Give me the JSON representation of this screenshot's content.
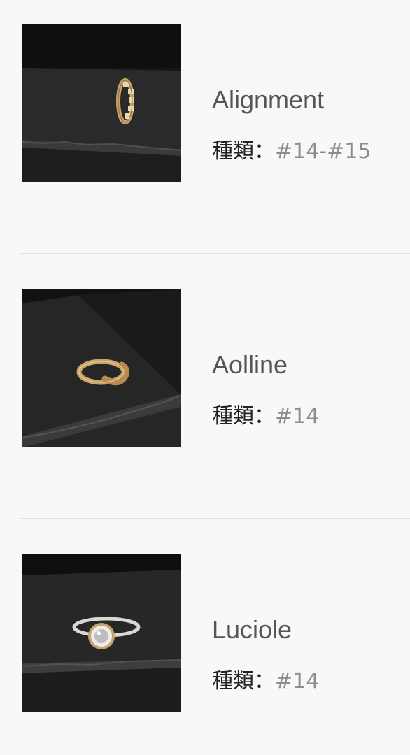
{
  "products": [
    {
      "name": "Alignment",
      "type_label": "種類：",
      "type_value": "#14-#15",
      "image_icon": "gold-eternity-ring-photo"
    },
    {
      "name": "Aolline",
      "type_label": "種類：",
      "type_value": "#14",
      "image_icon": "gold-organic-ring-photo"
    },
    {
      "name": "Luciole",
      "type_label": "種類：",
      "type_value": "#14",
      "image_icon": "silver-solitaire-ring-photo"
    }
  ],
  "colors": {
    "background": "#f8f8f8",
    "name_text": "#555555",
    "label_text": "#222222",
    "value_text": "#8d8d8d",
    "divider": "#e2e2e2",
    "gold": "#c9a46a",
    "silver": "#d9d9d4"
  }
}
